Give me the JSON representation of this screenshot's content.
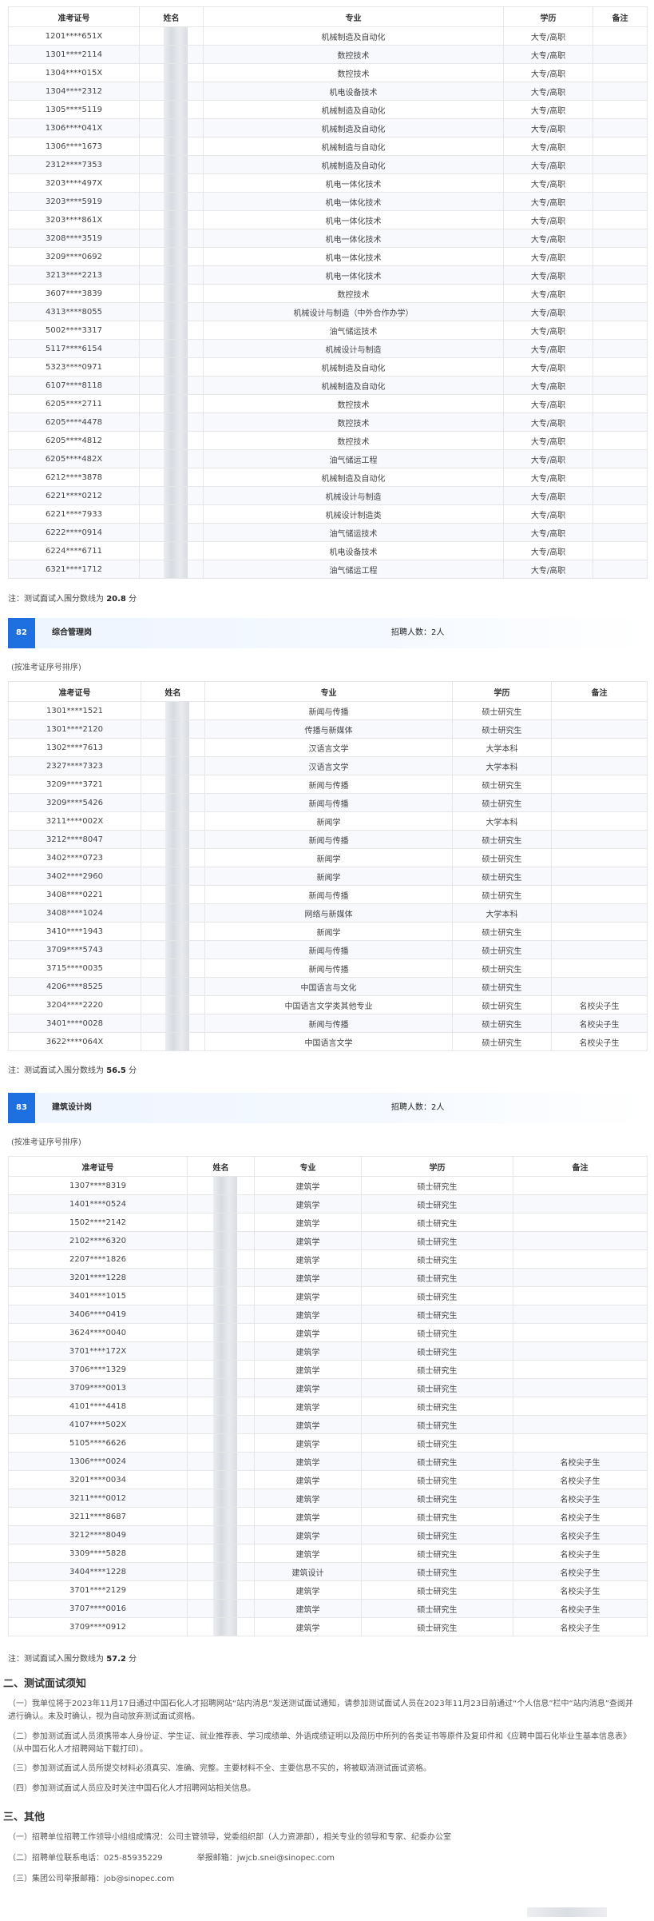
{
  "table1": {
    "headers": {
      "id": "准考证号",
      "name": "姓名",
      "major": "专业",
      "edu": "学历",
      "remark": "备注"
    },
    "rows": [
      [
        "1201****651X",
        "机械制造及自动化",
        "大专/高职",
        ""
      ],
      [
        "1301****2114",
        "数控技术",
        "大专/高职",
        ""
      ],
      [
        "1304****015X",
        "数控技术",
        "大专/高职",
        ""
      ],
      [
        "1304****2312",
        "机电设备技术",
        "大专/高职",
        ""
      ],
      [
        "1305****5119",
        "机械制造及自动化",
        "大专/高职",
        ""
      ],
      [
        "1306****041X",
        "机械制造及自动化",
        "大专/高职",
        ""
      ],
      [
        "1306****1673",
        "机械制造与自动化",
        "大专/高职",
        ""
      ],
      [
        "2312****7353",
        "机械制造及自动化",
        "大专/高职",
        ""
      ],
      [
        "3203****497X",
        "机电一体化技术",
        "大专/高职",
        ""
      ],
      [
        "3203****5919",
        "机电一体化技术",
        "大专/高职",
        ""
      ],
      [
        "3203****861X",
        "机电一体化技术",
        "大专/高职",
        ""
      ],
      [
        "3208****3519",
        "机电一体化技术",
        "大专/高职",
        ""
      ],
      [
        "3209****0692",
        "机电一体化技术",
        "大专/高职",
        ""
      ],
      [
        "3213****2213",
        "机电一体化技术",
        "大专/高职",
        ""
      ],
      [
        "3607****3839",
        "数控技术",
        "大专/高职",
        ""
      ],
      [
        "4313****8055",
        "机械设计与制造（中外合作办学）",
        "大专/高职",
        ""
      ],
      [
        "5002****3317",
        "油气储运技术",
        "大专/高职",
        ""
      ],
      [
        "5117****6154",
        "机械设计与制造",
        "大专/高职",
        ""
      ],
      [
        "5323****0971",
        "机械制造及自动化",
        "大专/高职",
        ""
      ],
      [
        "6107****8118",
        "机械制造及自动化",
        "大专/高职",
        ""
      ],
      [
        "6205****2711",
        "数控技术",
        "大专/高职",
        ""
      ],
      [
        "6205****4478",
        "数控技术",
        "大专/高职",
        ""
      ],
      [
        "6205****4812",
        "数控技术",
        "大专/高职",
        ""
      ],
      [
        "6205****482X",
        "油气储运工程",
        "大专/高职",
        ""
      ],
      [
        "6212****3878",
        "机械制造及自动化",
        "大专/高职",
        ""
      ],
      [
        "6221****0212",
        "机械设计与制造",
        "大专/高职",
        ""
      ],
      [
        "6221****7933",
        "机械设计制造类",
        "大专/高职",
        ""
      ],
      [
        "6222****0914",
        "油气储运技术",
        "大专/高职",
        ""
      ],
      [
        "6224****6711",
        "机电设备技术",
        "大专/高职",
        ""
      ],
      [
        "6321****1712",
        "油气储运工程",
        "大专/高职",
        ""
      ]
    ],
    "note_prefix": "注：测试面试入围分数线为",
    "score": "20.8",
    "note_suffix": "分"
  },
  "section82": {
    "num": "82",
    "post": "综合管理岗",
    "recruit": "招聘人数：2人",
    "sort": "(按准考证序号排序)"
  },
  "table2": {
    "headers": {
      "id": "准考证号",
      "name": "姓名",
      "major": "专业",
      "edu": "学历",
      "remark": "备注"
    },
    "rows": [
      [
        "1301****1521",
        "新闻与传播",
        "硕士研究生",
        ""
      ],
      [
        "1301****2120",
        "传播与新媒体",
        "硕士研究生",
        ""
      ],
      [
        "1302****7613",
        "汉语言文学",
        "大学本科",
        ""
      ],
      [
        "2327****7323",
        "汉语言文学",
        "大学本科",
        ""
      ],
      [
        "3209****3721",
        "新闻与传播",
        "硕士研究生",
        ""
      ],
      [
        "3209****5426",
        "新闻与传播",
        "硕士研究生",
        ""
      ],
      [
        "3211****002X",
        "新闻学",
        "大学本科",
        ""
      ],
      [
        "3212****8047",
        "新闻与传播",
        "硕士研究生",
        ""
      ],
      [
        "3402****0723",
        "新闻学",
        "硕士研究生",
        ""
      ],
      [
        "3402****2960",
        "新闻学",
        "硕士研究生",
        ""
      ],
      [
        "3408****0221",
        "新闻与传播",
        "硕士研究生",
        ""
      ],
      [
        "3408****1024",
        "网络与新媒体",
        "大学本科",
        ""
      ],
      [
        "3410****1943",
        "新闻学",
        "硕士研究生",
        ""
      ],
      [
        "3709****5743",
        "新闻与传播",
        "硕士研究生",
        ""
      ],
      [
        "3715****0035",
        "新闻与传播",
        "硕士研究生",
        ""
      ],
      [
        "4206****8525",
        "中国语言与文化",
        "硕士研究生",
        ""
      ],
      [
        "3204****2220",
        "中国语言文学类其他专业",
        "硕士研究生",
        "名校尖子生"
      ],
      [
        "3401****0028",
        "新闻与传播",
        "硕士研究生",
        "名校尖子生"
      ],
      [
        "3622****064X",
        "中国语言文学",
        "硕士研究生",
        "名校尖子生"
      ]
    ],
    "note_prefix": "注：测试面试入围分数线为",
    "score": "56.5",
    "note_suffix": "分"
  },
  "section83": {
    "num": "83",
    "post": "建筑设计岗",
    "recruit": "招聘人数：2人",
    "sort": "(按准考证序号排序)"
  },
  "table3": {
    "headers": {
      "id": "准考证号",
      "name": "姓名",
      "major": "专业",
      "edu": "学历",
      "remark": "备注"
    },
    "rows": [
      [
        "1307****8319",
        "建筑学",
        "硕士研究生",
        ""
      ],
      [
        "1401****0524",
        "建筑学",
        "硕士研究生",
        ""
      ],
      [
        "1502****2142",
        "建筑学",
        "硕士研究生",
        ""
      ],
      [
        "2102****6320",
        "建筑学",
        "硕士研究生",
        ""
      ],
      [
        "2207****1826",
        "建筑学",
        "硕士研究生",
        ""
      ],
      [
        "3201****1228",
        "建筑学",
        "硕士研究生",
        ""
      ],
      [
        "3401****1015",
        "建筑学",
        "硕士研究生",
        ""
      ],
      [
        "3406****0419",
        "建筑学",
        "硕士研究生",
        ""
      ],
      [
        "3624****0040",
        "建筑学",
        "硕士研究生",
        ""
      ],
      [
        "3701****172X",
        "建筑学",
        "硕士研究生",
        ""
      ],
      [
        "3706****1329",
        "建筑学",
        "硕士研究生",
        ""
      ],
      [
        "3709****0013",
        "建筑学",
        "硕士研究生",
        ""
      ],
      [
        "4101****4418",
        "建筑学",
        "硕士研究生",
        ""
      ],
      [
        "4107****502X",
        "建筑学",
        "硕士研究生",
        ""
      ],
      [
        "5105****6626",
        "建筑学",
        "硕士研究生",
        ""
      ],
      [
        "1306****0024",
        "建筑学",
        "硕士研究生",
        "名校尖子生"
      ],
      [
        "3201****0034",
        "建筑学",
        "硕士研究生",
        "名校尖子生"
      ],
      [
        "3211****0012",
        "建筑学",
        "硕士研究生",
        "名校尖子生"
      ],
      [
        "3211****8687",
        "建筑学",
        "硕士研究生",
        "名校尖子生"
      ],
      [
        "3212****8049",
        "建筑学",
        "硕士研究生",
        "名校尖子生"
      ],
      [
        "3309****5828",
        "建筑学",
        "硕士研究生",
        "名校尖子生"
      ],
      [
        "3404****1228",
        "建筑设计",
        "硕士研究生",
        "名校尖子生"
      ],
      [
        "3701****2129",
        "建筑学",
        "硕士研究生",
        "名校尖子生"
      ],
      [
        "3707****0016",
        "建筑学",
        "硕士研究生",
        "名校尖子生"
      ],
      [
        "3709****0912",
        "建筑学",
        "硕士研究生",
        "名校尖子生"
      ]
    ],
    "note_prefix": "注：测试面试入围分数线为",
    "score": "57.2",
    "note_suffix": "分"
  },
  "notice": {
    "title": "二、测试面试须知",
    "p1": "（一）我单位将于2023年11月17日通过中国石化人才招聘网站“站内消息”发送测试面试通知，请参加测试面试人员在2023年11月23日前通过“个人信息”栏中“站内消息”查阅并进行确认。未及时确认，视为自动放弃测试面试资格。",
    "p2": "（二）参加测试面试人员须携带本人身份证、学生证、就业推荐表、学习成绩单、外语成绩证明以及简历中所列的各类证书等原件及复印件和《应聘中国石化毕业生基本信息表》（从中国石化人才招聘网站下载打印）。",
    "p3": "（三）参加测试面试人员所提交材料必须真实、准确、完整。主要材料不全、主要信息不实的，将被取消测试面试资格。",
    "p4": "（四）参加测试面试人员应及时关注中国石化人才招聘网站相关信息。"
  },
  "other": {
    "title": "三、其他",
    "p1": "（一）招聘单位招聘工作领导小组组成情况：公司主管领导，党委组织部（人力资源部），相关专业的领导和专家、纪委办公室",
    "p2_a": "（二）招聘单位联系电话：025-85935229",
    "p2_b": "举报邮箱：jwjcb.snei@sinopec.com",
    "p3": "（三）集团公司举报邮箱：job@sinopec.com"
  }
}
